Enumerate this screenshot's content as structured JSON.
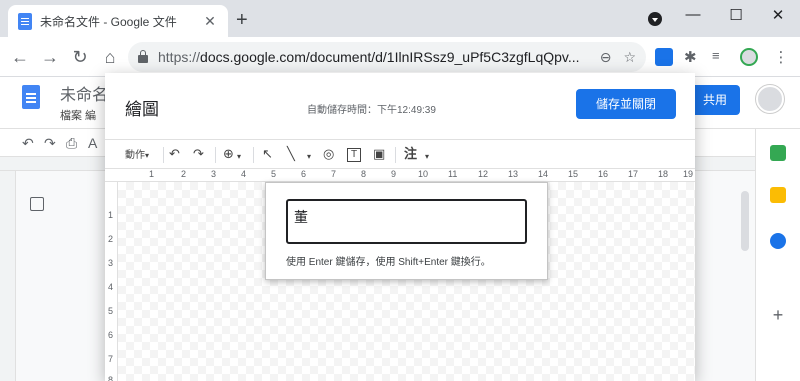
{
  "browser": {
    "tab_title": "未命名文件 - Google 文件",
    "tab_close": "✕",
    "new_tab": "+",
    "window_controls": {
      "minimize": "—",
      "maximize": "☐",
      "close": "✕"
    },
    "nav": {
      "back": "←",
      "forward": "→",
      "reload": "↻",
      "home": "⌂"
    },
    "url_scheme": "https://",
    "url_rest": "docs.google.com/document/d/1IlnIRSsz9_uPf5C3zgfLqQpv...",
    "zoom_icon": "⊖",
    "star_icon": "☆"
  },
  "docs": {
    "title": "未命名",
    "menu": "檔案  編",
    "share_label": "共用"
  },
  "dialog": {
    "title": "繪圖",
    "autosave": "自動儲存時間：下午12:49:39",
    "save_close_label": "儲存並關閉",
    "toolbar": {
      "actions_label": "動作",
      "actions_caret": "▾",
      "undo": "↶",
      "redo": "↷",
      "zoom": "⊕",
      "zoom_caret": "▾",
      "select": "↖",
      "line": "╲",
      "line_caret": "▾",
      "shape": "◎",
      "textbox": "T",
      "image": "▣",
      "wordart_label": "注",
      "wordart_caret": "▾"
    },
    "ruler_numbers": [
      "1",
      "2",
      "3",
      "4",
      "5",
      "6",
      "7",
      "8",
      "9",
      "10",
      "11",
      "12",
      "13",
      "14",
      "15",
      "16",
      "17",
      "18",
      "19"
    ],
    "vruler_numbers": [
      "1",
      "2",
      "3",
      "4",
      "5",
      "6",
      "7",
      "8"
    ],
    "wordart": {
      "input_value": "董",
      "hint": "使用 Enter 鍵儲存，使用 Shift+Enter 鍵換行。"
    }
  }
}
